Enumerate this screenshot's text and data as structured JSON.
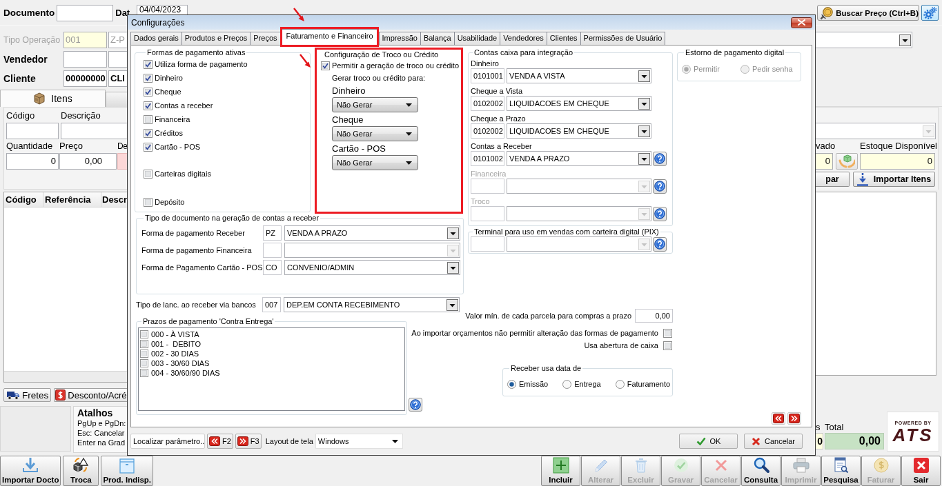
{
  "app": {
    "header": {
      "document_label": "Documento",
      "date_label": "Dat",
      "date_value": "04/04/2023",
      "price_lookup_button": "Buscar Preço (Ctrl+B)"
    },
    "operation": {
      "label": "Tipo Operação",
      "disabled": true,
      "code": "001",
      "name": "Z-P"
    },
    "seller": {
      "label": "Vendedor",
      "disabled": false
    },
    "customer": {
      "label": "Cliente",
      "disabled": false,
      "code": "00000000",
      "name": "CLI"
    },
    "item_tabs": [
      {
        "label": "Itens",
        "selected": true
      },
      {
        "selected": false
      }
    ],
    "item_fields": [
      {
        "label": "Código"
      },
      {
        "label": "Descrição"
      }
    ],
    "qty_fields": [
      {
        "label": "Quantidade",
        "value": "0",
        "tinted": false
      },
      {
        "label": "Preço",
        "value": "0,00",
        "tinted": false
      },
      {
        "label": "De",
        "tinted": true
      }
    ],
    "item_dropdown": {
      "disabled": true
    },
    "stock": {
      "reserved_label": "vado",
      "reserved_value": "0",
      "available_label": "Estoque Disponível",
      "available_value": "0"
    },
    "item_buttons": [
      {
        "label": "par",
        "kind": "plain"
      },
      {
        "label": "Importar Itens",
        "kind": "import"
      }
    ],
    "grid_columns": [
      "Código",
      "Referência",
      "Descr"
    ],
    "extra_buttons": [
      {
        "label": "Fretes",
        "kind": "freight"
      },
      {
        "label": "Desconto/Acré",
        "kind": "discount"
      }
    ],
    "shortcuts": {
      "title": "Atalhos",
      "lines": [
        "PgUp e PgDn:",
        "Esc: Cancelar",
        "Enter na Grad"
      ]
    },
    "totals": {
      "partial_label": "s",
      "partial_value": "0",
      "total_label": "Total",
      "total_value": "0,00"
    },
    "logo": {
      "tagline": "POWERED BY",
      "name": "ATS"
    },
    "toolbar_left": [
      {
        "label": "Importar Docto",
        "kind": "import",
        "disabled": false
      },
      {
        "label": "Troca",
        "kind": "exchange",
        "disabled": false
      },
      {
        "label": "Prod. Indisp.",
        "kind": "box",
        "disabled": false
      }
    ],
    "toolbar_right": [
      {
        "label": "Incluir",
        "kind": "add",
        "disabled": false
      },
      {
        "label": "Alterar",
        "kind": "edit",
        "disabled": true
      },
      {
        "label": "Excluir",
        "kind": "delete",
        "disabled": true
      },
      {
        "label": "Gravar",
        "kind": "save",
        "disabled": true
      },
      {
        "label": "Cancelar",
        "kind": "cancel",
        "disabled": true
      },
      {
        "label": "Consulta",
        "kind": "search",
        "disabled": false
      },
      {
        "label": "Imprimir",
        "kind": "print",
        "disabled": true
      },
      {
        "label": "Pesquisa",
        "kind": "report",
        "disabled": false
      },
      {
        "label": "Faturar",
        "kind": "bill",
        "disabled": true
      },
      {
        "label": "Sair",
        "kind": "exit",
        "disabled": false
      }
    ]
  },
  "dialog": {
    "title": "Configurações",
    "tabs": [
      {
        "label": "Dados gerais",
        "selected": false,
        "highlighted": false
      },
      {
        "label": "Produtos e Preços",
        "selected": false,
        "highlighted": false
      },
      {
        "label": "Preços",
        "selected": false,
        "highlighted": false
      },
      {
        "label": "Faturamento e Financeiro",
        "selected": true,
        "highlighted": true
      },
      {
        "label": "Impressão",
        "selected": false,
        "highlighted": false
      },
      {
        "label": "Balança",
        "selected": false,
        "highlighted": false
      },
      {
        "label": "Usabilidade",
        "selected": false,
        "highlighted": false
      },
      {
        "label": "Vendedores",
        "selected": false,
        "highlighted": false
      },
      {
        "label": "Clientes",
        "selected": false,
        "highlighted": false
      },
      {
        "label": "Permissões de Usuário",
        "selected": false,
        "highlighted": false
      }
    ],
    "payment_methods": {
      "title": "Formas de pagamento ativas",
      "items": [
        {
          "label": "Utiliza forma de pagamento",
          "checked": true
        },
        {
          "label": "Dinheiro",
          "checked": true
        },
        {
          "label": "Cheque",
          "checked": true
        },
        {
          "label": "Contas a receber",
          "checked": true
        },
        {
          "label": "Financeira",
          "checked": false
        },
        {
          "label": "Créditos",
          "checked": true
        },
        {
          "label": "Cartão - POS",
          "checked": true
        },
        {
          "label": "Carteiras digitais",
          "checked": false
        },
        {
          "label": "Depósito",
          "checked": false
        }
      ]
    },
    "change_settings": {
      "title": "Configuração de Troco ou Crédito",
      "highlighted": true,
      "allow": {
        "label": "Permitir a geração de troco ou crédito",
        "checked": true
      },
      "subtitle": "Gerar troco ou crédito para:",
      "targets": [
        {
          "label": "Dinheiro",
          "value": "Não Gerar"
        },
        {
          "label": "Cheque",
          "value": "Não Gerar"
        },
        {
          "label": "Cartão - POS",
          "value": "Não Gerar"
        }
      ]
    },
    "cash_accounts": {
      "title": "Contas caixa para integração",
      "items": [
        {
          "label": "Dinheiro",
          "code": "0101001",
          "account": "VENDA A VISTA",
          "disabled": false,
          "help": false
        },
        {
          "label": "Cheque a Vista",
          "code": "0102002",
          "account": "LIQUIDACOES EM CHEQUE",
          "disabled": false,
          "help": false
        },
        {
          "label": "Cheque a Prazo",
          "code": "0102002",
          "account": "LIQUIDACOES EM CHEQUE",
          "disabled": false,
          "help": false
        },
        {
          "label": "Contas a Receber",
          "code": "0101002",
          "account": "VENDA A PRAZO",
          "disabled": false,
          "help": true
        },
        {
          "label": "Financeira",
          "disabled": true,
          "help": true
        },
        {
          "label": "Troco",
          "disabled": true,
          "help": true
        }
      ]
    },
    "pix_terminal": {
      "title": "Terminal para uso em vendas com carteira digital (PIX)",
      "disabled": true,
      "help": true
    },
    "digital_refund": {
      "title": "Estorno de pagamento digital",
      "disabled": true,
      "options": [
        {
          "label": "Permitir",
          "selected": true
        },
        {
          "label": "Pedir senha",
          "selected": false
        }
      ]
    },
    "document_types": {
      "title": "Tipo de documento na geração de contas a receber",
      "items": [
        {
          "label": "Forma de pagamento Receber",
          "code": "PZ",
          "value": "VENDA A PRAZO",
          "disabled": false
        },
        {
          "label": "Forma de pagamento Financeira",
          "disabled": true
        },
        {
          "label": "Forma de Pagamento Cartão - POS",
          "code": "CO",
          "value": "CONVENIO/ADMIN",
          "disabled": false
        }
      ]
    },
    "bank_entry": {
      "label": "Tipo de lanc. ao receber via bancos",
      "code": "007",
      "value": "DEP.EM CONTA RECEBIMENTO"
    },
    "min_installment": {
      "label": "Valor mín. de cada parcela para compras a prazo",
      "value": "0,00"
    },
    "cod_terms": {
      "title": "Prazos de pagamento 'Contra Entrega'",
      "help": true,
      "items": [
        {
          "label": "000 - À VISTA",
          "checked": false
        },
        {
          "label": "001 -  DEBITO",
          "checked": false
        },
        {
          "label": "002 - 30 DIAS",
          "checked": false
        },
        {
          "label": "003 - 30/60 DIAS",
          "checked": false
        },
        {
          "label": "004 - 30/60/90 DIAS",
          "checked": false
        }
      ]
    },
    "options": [
      {
        "label": "Ao importar orçamentos não permitir alteração das formas de pagamento",
        "checked": false
      },
      {
        "label": "Usa abertura de caixa",
        "checked": false
      }
    ],
    "receive_date": {
      "title": "Receber usa data de",
      "options": [
        {
          "label": "Emissão",
          "selected": true
        },
        {
          "label": "Entrega",
          "selected": false
        },
        {
          "label": "Faturamento",
          "selected": false
        }
      ]
    },
    "footer": {
      "find_button": "Localizar parâmetro..",
      "prev_key": "F2",
      "next_key": "F3",
      "layout_label": "Layout de tela",
      "layout_value": "Windows",
      "ok_button": "OK",
      "cancel_button": "Cancelar"
    }
  }
}
